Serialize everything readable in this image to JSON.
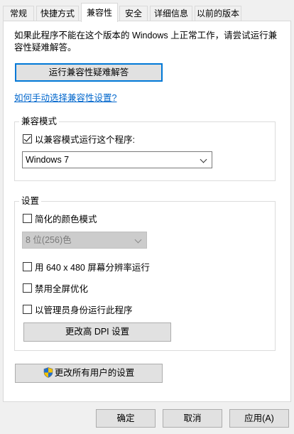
{
  "tabs": [
    {
      "label": "常规"
    },
    {
      "label": "快捷方式"
    },
    {
      "label": "兼容性"
    },
    {
      "label": "安全"
    },
    {
      "label": "详细信息"
    },
    {
      "label": "以前的版本"
    }
  ],
  "intro_text": "如果此程序不能在这个版本的 Windows 上正常工作，请尝试运行兼容性疑难解答。",
  "troubleshoot_button": "运行兼容性疑难解答",
  "manual_link": "如何手动选择兼容性设置?",
  "compat_mode": {
    "title": "兼容模式",
    "checkbox_label": "以兼容模式运行这个程序:",
    "checked": true,
    "selected_os": "Windows 7"
  },
  "settings": {
    "title": "设置",
    "reduced_color_label": "简化的颜色模式",
    "color_depth_value": "8 位(256)色",
    "res_640_label": "用 640 x 480 屏幕分辨率运行",
    "disable_fullscreen_label": "禁用全屏优化",
    "run_as_admin_label": "以管理员身份运行此程序",
    "dpi_button": "更改高 DPI 设置"
  },
  "all_users_button": "更改所有用户的设置",
  "footer": {
    "ok": "确定",
    "cancel": "取消",
    "apply": "应用(A)"
  },
  "colors": {
    "accent": "#0078d7",
    "link": "#0066cc"
  }
}
